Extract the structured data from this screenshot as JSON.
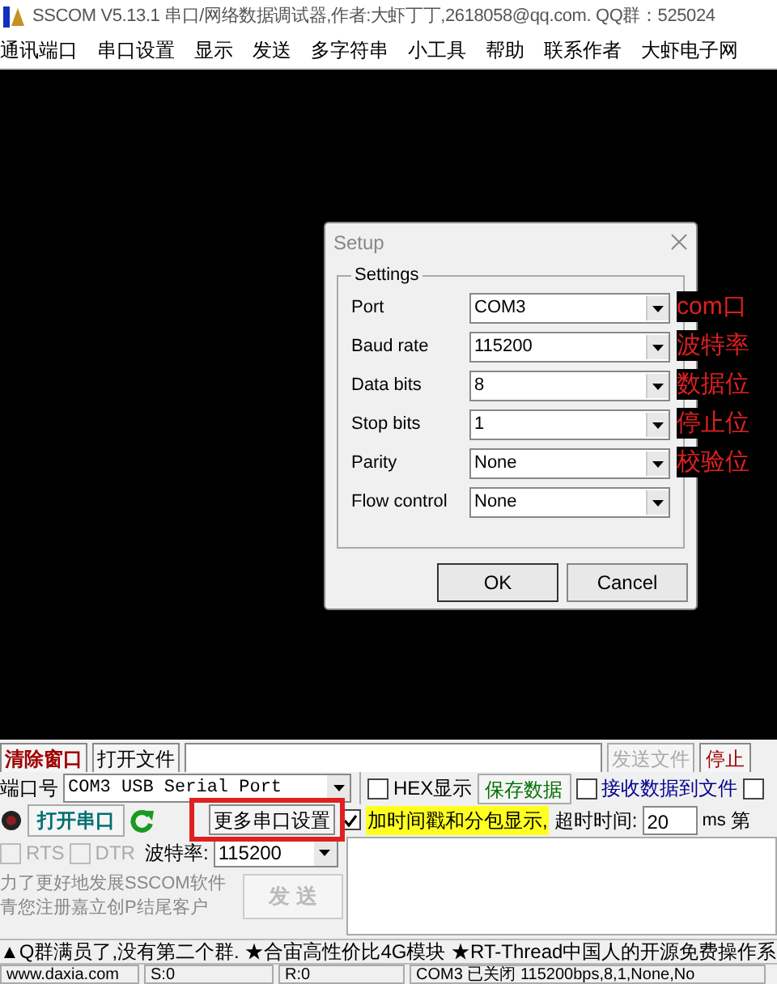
{
  "window": {
    "title": "SSCOM V5.13.1 串口/网络数据调试器,作者:大虾丁丁,2618058@qq.com. QQ群：525024"
  },
  "menu": [
    "通讯端口",
    "串口设置",
    "显示",
    "发送",
    "多字符串",
    "小工具",
    "帮助",
    "联系作者",
    "大虾电子网"
  ],
  "dialog": {
    "title": "Setup",
    "group": "Settings",
    "fields": [
      {
        "label": "Port",
        "value": "COM3",
        "note": "com口"
      },
      {
        "label": "Baud rate",
        "value": "115200",
        "note": "波特率"
      },
      {
        "label": "Data bits",
        "value": "8",
        "note": "数据位"
      },
      {
        "label": "Stop bits",
        "value": "1",
        "note": "停止位"
      },
      {
        "label": "Parity",
        "value": "None",
        "note": "校验位"
      },
      {
        "label": "Flow control",
        "value": "None"
      }
    ],
    "buttons": [
      "OK",
      "Cancel"
    ]
  },
  "toolbar": {
    "clear_button": "清除窗口",
    "open_file_button": "打开文件",
    "send_file_button": "发送文件",
    "stop_button": "停止"
  },
  "port_row": {
    "label": "端口号",
    "port": "COM3 USB Serial Port",
    "hex_display": {
      "label": "HEX显示",
      "checked": false
    },
    "save_button": "保存数据",
    "receive_to_file": {
      "label": "接收数据到文件",
      "checked": false
    },
    "extra_checkbox": {
      "checked": false
    }
  },
  "open_row": {
    "open_button": "打开串口",
    "more_settings_button": "更多串口设置",
    "timestamp": {
      "label": "加时间戳和分包显示,",
      "checked": true
    },
    "timeout_label": "超时时间:",
    "timeout": "20",
    "unit": "ms",
    "cut_label": "第"
  },
  "signal_row": {
    "rts": {
      "label": "RTS",
      "checked": false,
      "disabled": true
    },
    "dtr": {
      "label": "DTR",
      "checked": false,
      "disabled": true
    },
    "baud_label": "波特率:",
    "baud": "115200"
  },
  "promo": [
    "力了更好地发展SSCOM软件",
    "青您注册嘉立创P结尾客户"
  ],
  "send_button": {
    "label": "发 送",
    "disabled": true
  },
  "ticker": "▲Q群满员了,没有第二个群. ★合宙高性价比4G模块 ★RT-Thread中国人的开源免费操作系",
  "status_bar": [
    "www.daxia.com",
    "S:0",
    "R:0",
    "COM3 已关闭 115200bps,8,1,None,No"
  ]
}
